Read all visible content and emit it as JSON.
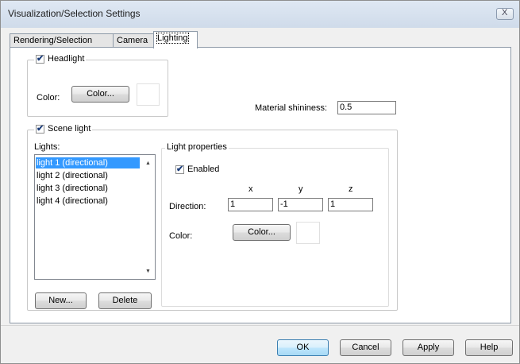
{
  "window": {
    "title": "Visualization/Selection Settings",
    "close_glyph": "X"
  },
  "tabs": [
    {
      "label": "Rendering/Selection"
    },
    {
      "label": "Camera"
    },
    {
      "label": "Lighting"
    }
  ],
  "headlight": {
    "label": "Headlight",
    "checked": true,
    "color_label": "Color:",
    "color_button": "Color...",
    "swatch_color": "#ffffff"
  },
  "material": {
    "label": "Material shininess:",
    "value": "0.5"
  },
  "scene_light": {
    "label": "Scene light",
    "checked": true,
    "lights_label": "Lights:",
    "lights": [
      {
        "label": "light 1 (directional)",
        "selected": true
      },
      {
        "label": "light 2 (directional)",
        "selected": false
      },
      {
        "label": "light 3 (directional)",
        "selected": false
      },
      {
        "label": "light 4 (directional)",
        "selected": false
      }
    ],
    "new_button": "New...",
    "delete_button": "Delete",
    "properties": {
      "title": "Light properties",
      "enabled_label": "Enabled",
      "enabled": true,
      "x_label": "x",
      "y_label": "y",
      "z_label": "z",
      "direction_label": "Direction:",
      "direction": {
        "x": "1",
        "y": "-1",
        "z": "1"
      },
      "color_label": "Color:",
      "color_button": "Color...",
      "swatch_color": "#ffffff"
    }
  },
  "buttons": {
    "ok": "OK",
    "cancel": "Cancel",
    "apply": "Apply",
    "help": "Help"
  },
  "icons": {
    "check": "✔",
    "scroll_up": "▲",
    "scroll_down": "▼"
  }
}
